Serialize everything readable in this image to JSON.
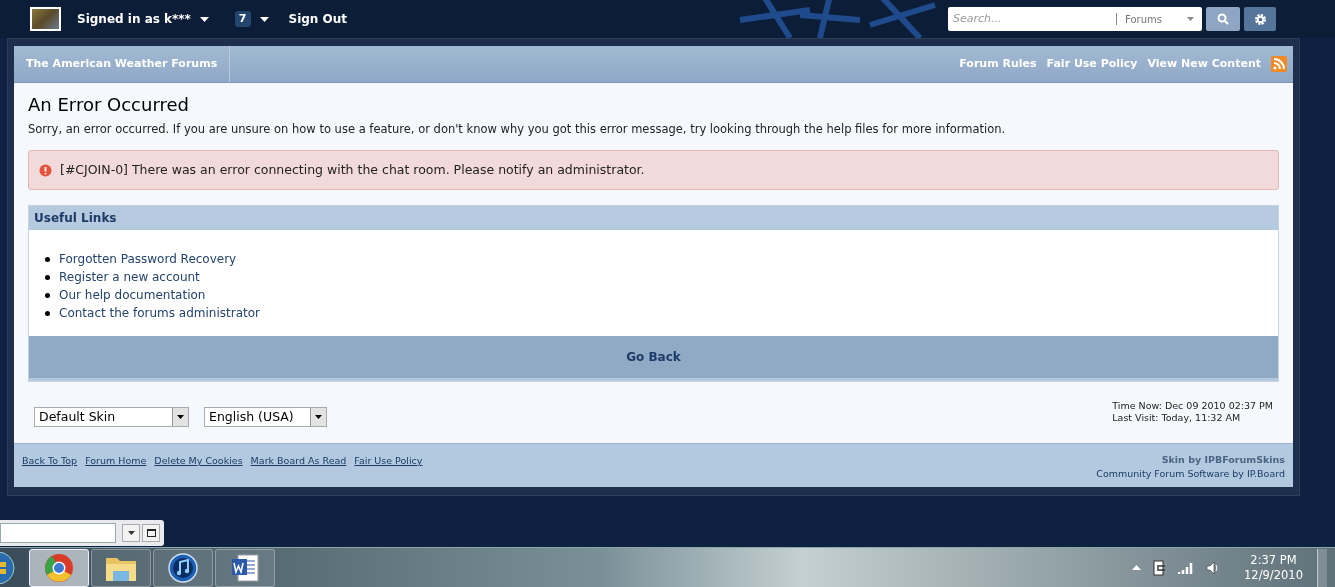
{
  "header": {
    "user": "Signed in as k***",
    "notifications": "7",
    "sign_out": "Sign Out",
    "search": {
      "placeholder": "Search..."
    },
    "search_scope": "Forums"
  },
  "breadcrumb": "The American Weather Forums",
  "nav_links": [
    "Forum Rules",
    "Fair Use Policy",
    "View New Content"
  ],
  "error_page": {
    "title": "An Error Occurred",
    "description": "Sorry, an error occurred. If you are unsure on how to use a feature, or don't know why you got this error message, try looking through the help files for more information.",
    "alert": "[#CJOIN-0] There was an error connecting with the chat room. Please notify an administrator.",
    "useful_links": {
      "title": "Useful Links",
      "items": [
        "Forgotten Password Recovery",
        "Register a new account",
        "Our help documentation",
        "Contact the forums administrator"
      ]
    },
    "go_back": "Go Back"
  },
  "selects": [
    {
      "value": "Default Skin"
    },
    {
      "value": "English (USA)"
    }
  ],
  "time_now": "Time Now: Dec 09 2010 02:37 PM",
  "last_visit": "Last Visit: Today, 11:32 AM",
  "footer_links": [
    "Back To Top",
    "Forum Home",
    "Delete My Cookies",
    "Mark Board As Read",
    "Fair Use Policy"
  ],
  "credit": "Skin by **IPBForumSkins**",
  "powered_by": "Community Forum Software by IP.Board",
  "taskbar": {
    "apps": [
      {
        "kind": "browser",
        "selected": true
      },
      {
        "kind": "folder",
        "selected": false
      },
      {
        "kind": "music",
        "selected": false
      },
      {
        "kind": "document",
        "selected": false
      }
    ],
    "time": "2:37 PM",
    "date": "12/9/2010"
  }
}
